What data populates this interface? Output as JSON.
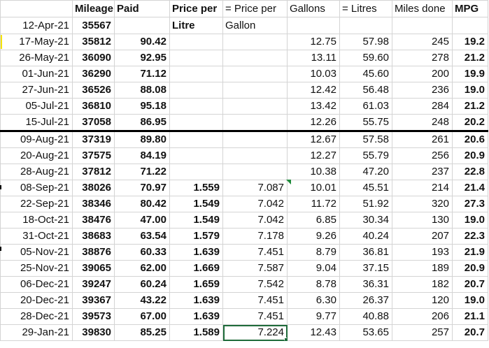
{
  "headers": {
    "row1": [
      "",
      "Mileage",
      "Paid",
      "Price per",
      "= Price per",
      "Gallons",
      "= Litres",
      "Miles done",
      "MPG"
    ],
    "row2_date": "12-Apr-21",
    "row2_mileage": "35567",
    "row2_price_sub": "Litre",
    "row2_gallon_sub": "Gallon"
  },
  "rows": [
    {
      "date": "17-May-21",
      "mileage": "35812",
      "paid": "90.42",
      "price_litre": "",
      "price_gallon": "",
      "gallons": "12.75",
      "litres": "57.98",
      "miles": "245",
      "mpg": "19.2"
    },
    {
      "date": "26-May-21",
      "mileage": "36090",
      "paid": "92.95",
      "price_litre": "",
      "price_gallon": "",
      "gallons": "13.11",
      "litres": "59.60",
      "miles": "278",
      "mpg": "21.2"
    },
    {
      "date": "01-Jun-21",
      "mileage": "36290",
      "paid": "71.12",
      "price_litre": "",
      "price_gallon": "",
      "gallons": "10.03",
      "litres": "45.60",
      "miles": "200",
      "mpg": "19.9"
    },
    {
      "date": "27-Jun-21",
      "mileage": "36526",
      "paid": "88.08",
      "price_litre": "",
      "price_gallon": "",
      "gallons": "12.42",
      "litres": "56.48",
      "miles": "236",
      "mpg": "19.0"
    },
    {
      "date": "05-Jul-21",
      "mileage": "36810",
      "paid": "95.18",
      "price_litre": "",
      "price_gallon": "",
      "gallons": "13.42",
      "litres": "61.03",
      "miles": "284",
      "mpg": "21.2"
    },
    {
      "date": "15-Jul-21",
      "mileage": "37058",
      "paid": "86.95",
      "price_litre": "",
      "price_gallon": "",
      "gallons": "12.26",
      "litres": "55.75",
      "miles": "248",
      "mpg": "20.2"
    },
    {
      "date": "09-Aug-21",
      "mileage": "37319",
      "paid": "89.80",
      "price_litre": "",
      "price_gallon": "",
      "gallons": "12.67",
      "litres": "57.58",
      "miles": "261",
      "mpg": "20.6"
    },
    {
      "date": "20-Aug-21",
      "mileage": "37575",
      "paid": "84.19",
      "price_litre": "",
      "price_gallon": "",
      "gallons": "12.27",
      "litres": "55.79",
      "miles": "256",
      "mpg": "20.9"
    },
    {
      "date": "28-Aug-21",
      "mileage": "37812",
      "paid": "71.22",
      "price_litre": "",
      "price_gallon": "",
      "gallons": "10.38",
      "litres": "47.20",
      "miles": "237",
      "mpg": "22.8"
    },
    {
      "date": "08-Sep-21",
      "mileage": "38026",
      "paid": "70.97",
      "price_litre": "1.559",
      "price_gallon": "7.087",
      "gallons": "10.01",
      "litres": "45.51",
      "miles": "214",
      "mpg": "21.4"
    },
    {
      "date": "22-Sep-21",
      "mileage": "38346",
      "paid": "80.42",
      "price_litre": "1.549",
      "price_gallon": "7.042",
      "gallons": "11.72",
      "litres": "51.92",
      "miles": "320",
      "mpg": "27.3"
    },
    {
      "date": "18-Oct-21",
      "mileage": "38476",
      "paid": "47.00",
      "price_litre": "1.549",
      "price_gallon": "7.042",
      "gallons": "6.85",
      "litres": "30.34",
      "miles": "130",
      "mpg": "19.0"
    },
    {
      "date": "31-Oct-21",
      "mileage": "38683",
      "paid": "63.54",
      "price_litre": "1.579",
      "price_gallon": "7.178",
      "gallons": "9.26",
      "litres": "40.24",
      "miles": "207",
      "mpg": "22.3"
    },
    {
      "date": "05-Nov-21",
      "mileage": "38876",
      "paid": "60.33",
      "price_litre": "1.639",
      "price_gallon": "7.451",
      "gallons": "8.79",
      "litres": "36.81",
      "miles": "193",
      "mpg": "21.9"
    },
    {
      "date": "25-Nov-21",
      "mileage": "39065",
      "paid": "62.00",
      "price_litre": "1.669",
      "price_gallon": "7.587",
      "gallons": "9.04",
      "litres": "37.15",
      "miles": "189",
      "mpg": "20.9"
    },
    {
      "date": "06-Dec-21",
      "mileage": "39247",
      "paid": "60.24",
      "price_litre": "1.659",
      "price_gallon": "7.542",
      "gallons": "8.78",
      "litres": "36.31",
      "miles": "182",
      "mpg": "20.7"
    },
    {
      "date": "20-Dec-21",
      "mileage": "39367",
      "paid": "43.22",
      "price_litre": "1.639",
      "price_gallon": "7.451",
      "gallons": "6.30",
      "litres": "26.37",
      "miles": "120",
      "mpg": "19.0"
    },
    {
      "date": "28-Dec-21",
      "mileage": "39573",
      "paid": "67.00",
      "price_litre": "1.639",
      "price_gallon": "7.451",
      "gallons": "9.77",
      "litres": "40.88",
      "miles": "206",
      "mpg": "21.1"
    },
    {
      "date": "29-Jan-21",
      "mileage": "39830",
      "paid": "85.25",
      "price_litre": "1.589",
      "price_gallon": "7.224",
      "gallons": "12.43",
      "litres": "53.65",
      "miles": "257",
      "mpg": "20.7"
    }
  ],
  "colors": {
    "grid": "#d4d4d4",
    "selection": "#1e6b3a",
    "row_marker": "#f5e400"
  }
}
